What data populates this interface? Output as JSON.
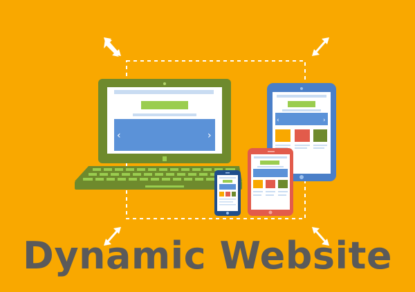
{
  "headline": "Dynamic Website",
  "icons": {
    "laptop": "laptop-icon",
    "tablet": "tablet-icon",
    "phone_large": "phone-large-icon",
    "phone_small": "phone-small-icon",
    "resize_arrows": "resize-arrow-icon"
  },
  "colors": {
    "background": "#f9a800",
    "laptop_body": "#6e8a2d",
    "laptop_keys": "#9acd4f",
    "screen_blue": "#5b92d8",
    "tablet_frame": "#4a7fc8",
    "phone_large_frame": "#e25b4b",
    "phone_small_frame": "#1f4e8c",
    "accent_green": "#9acd4f",
    "accent_red": "#e25b4b",
    "headline": "#5a5a5a"
  }
}
